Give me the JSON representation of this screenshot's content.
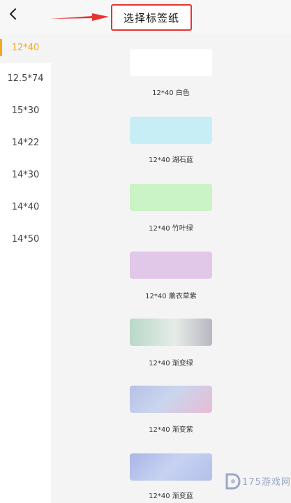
{
  "header": {
    "title": "选择标签纸"
  },
  "sizes": [
    {
      "label": "12*40",
      "active": true
    },
    {
      "label": "12.5*74",
      "active": false
    },
    {
      "label": "15*30",
      "active": false
    },
    {
      "label": "14*22",
      "active": false
    },
    {
      "label": "14*30",
      "active": false
    },
    {
      "label": "14*40",
      "active": false
    },
    {
      "label": "14*50",
      "active": false
    }
  ],
  "papers": [
    {
      "name": "12*40 白色",
      "color": "#ffffff"
    },
    {
      "name": "12*40 湖石蓝",
      "color": "#c8eef5"
    },
    {
      "name": "12*40 竹叶绿",
      "color": "#caf3c6"
    },
    {
      "name": "12*40 薰衣草紫",
      "color": "#e2c8e8"
    },
    {
      "name": "12*40 渐变绿",
      "color": "gradient"
    },
    {
      "name": "12*40 渐变紫",
      "color": "gradient"
    },
    {
      "name": "12*40 渐变蓝",
      "color": "gradient"
    }
  ],
  "colors": {
    "accent": "#f4a91a",
    "annotation": "#e8332f"
  },
  "watermark": {
    "text": "175游戏网"
  }
}
